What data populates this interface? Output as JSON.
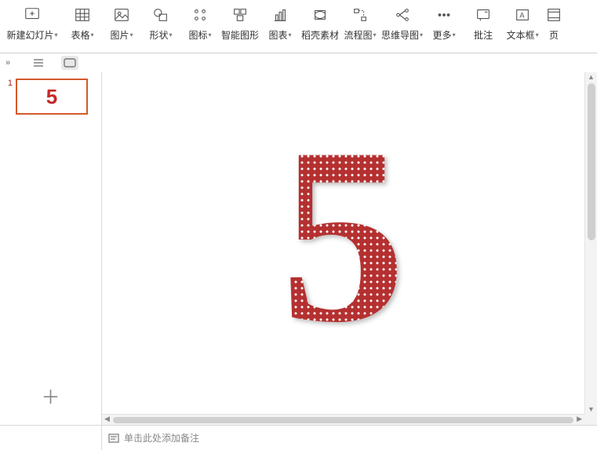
{
  "toolbar": {
    "new_slide": "新建幻灯片",
    "table": "表格",
    "image": "图片",
    "shape": "形状",
    "icon": "图标",
    "smart_art": "智能图形",
    "chart": "图表",
    "docer": "稻壳素材",
    "flowchart": "流程图",
    "mindmap": "思维导图",
    "more": "更多",
    "comment": "批注",
    "textbox": "文本框",
    "header_footer": "页"
  },
  "subbar": {
    "expand": "»"
  },
  "thumbs": {
    "items": [
      {
        "index": "1",
        "preview": "5"
      }
    ],
    "add": "＋"
  },
  "slide": {
    "content": "5"
  },
  "notes": {
    "placeholder": "单击此处添加备注"
  }
}
